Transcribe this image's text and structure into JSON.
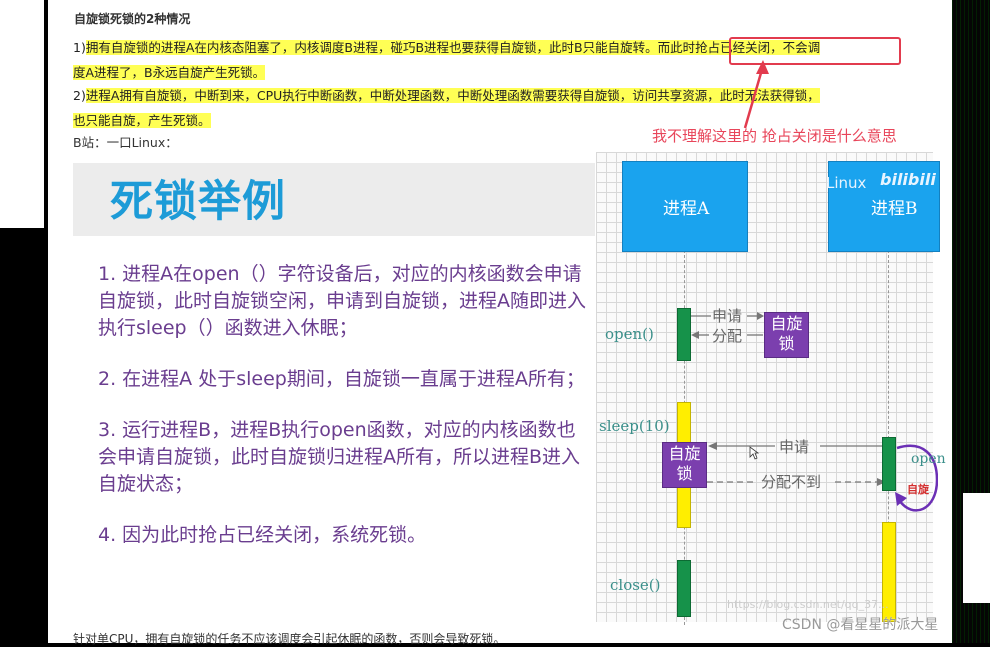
{
  "article": {
    "heading": "自旋锁死锁的2种情况",
    "para1_prefix": "1)",
    "para1_a": "拥有自旋锁的进程A在内核态阻塞了，内核调度B进程，碰巧B进程也要获得自旋锁，此时B只能自旋转。而此时抢占已经关闭，不会调",
    "para1_b": "度A进程了，B永远自旋产生死锁。",
    "para2_prefix": "2)",
    "para2_a": "进程A拥有自旋锁，中断到来，CPU执行中断函数，中断处理函数，中断处理函数需要获得自旋锁，访问共享资源，此时无法获得锁，",
    "para2_b": "也只能自旋，产生死锁。",
    "source": "B站：一口Linux：",
    "annotation": "我不理解这里的 抢占关闭是什么意思",
    "footer": "针对单CPU，拥有自旋锁的任务不应该调度会引起休眠的函数，否则会导致死锁。",
    "csdn": "CSDN @看星星的派大星",
    "watermark": "https://blog.csdn.net/qq_37..."
  },
  "slide": {
    "title": "死锁举例",
    "items": [
      "1. 进程A在open（）字符设备后，对应的内核函数会申请自旋锁，此时自旋锁空闲，申请到自旋锁，进程A随即进入执行sleep（）函数进入休眠；",
      "2. 在进程A 处于sleep期间，自旋锁一直属于进程A所有；",
      "3. 运行进程B，进程B执行open函数，对应的内核函数也会申请自旋锁，此时自旋锁归进程A所有，所以进程B进入自旋状态；",
      "4. 因为此时抢占已经关闭，系统死锁。"
    ]
  },
  "diagram": {
    "procA": "进程A",
    "procB": "进程B",
    "linux_logo": "Linux",
    "bili_logo": "bilibili",
    "open": "open()",
    "sleep": "sleep(10)",
    "close": "close()",
    "req1": "申请",
    "alloc1": "分配",
    "lock1": "自旋锁",
    "lock2": "自旋锁",
    "req2": "申请",
    "alloc2": "分配不到",
    "openB": "open",
    "spinB": "自旋",
    "colors": {
      "process": "#1aa3ee",
      "lock": "#7b3fae",
      "active": "#16924a",
      "sleep": "#ffee00"
    }
  }
}
